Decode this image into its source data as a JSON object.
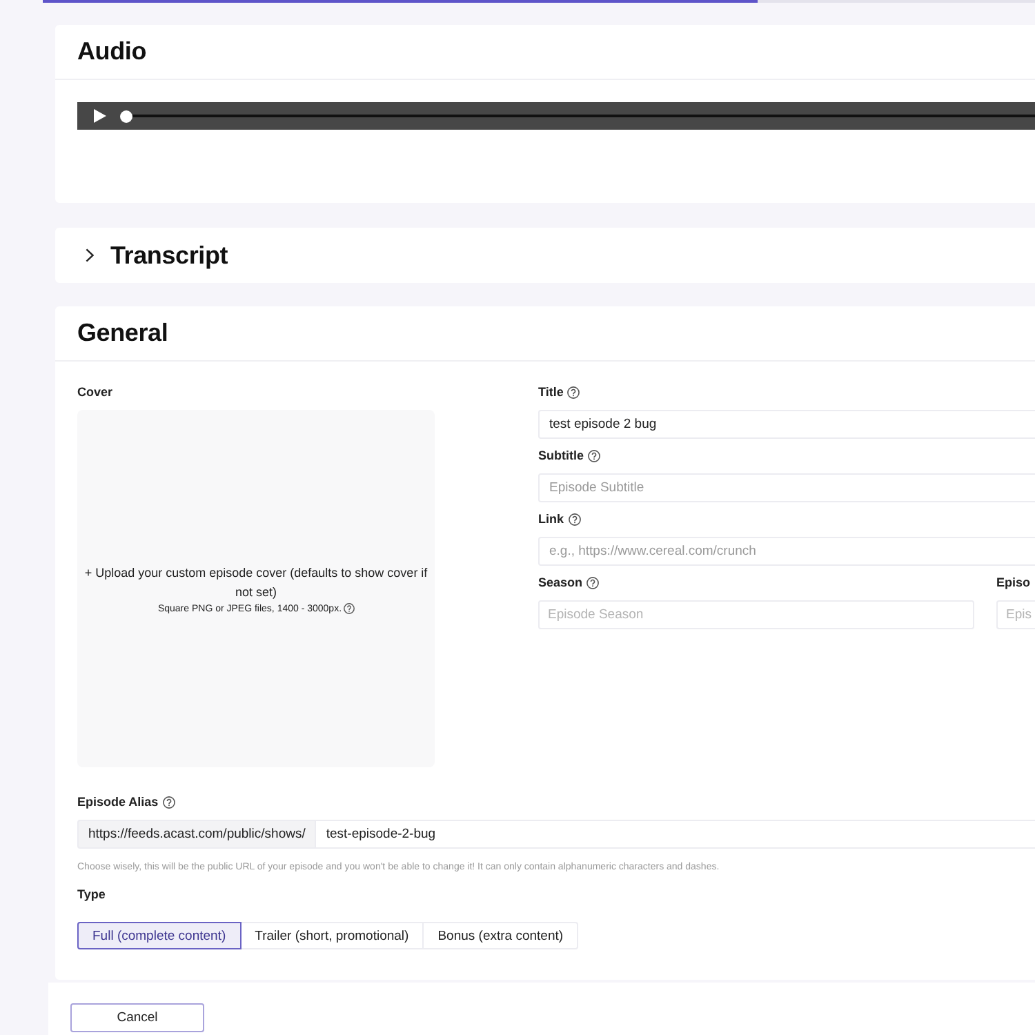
{
  "progress": {
    "level": 0.72
  },
  "audio_card": {
    "title": "Audio",
    "player": {
      "level": 0
    }
  },
  "transcript_card": {
    "title": "Transcript",
    "expanded": false
  },
  "general_card": {
    "title": "General",
    "cover": {
      "label": "Cover",
      "upload_text": "+ Upload your custom episode cover (defaults to show cover if not set)",
      "hint": "Square PNG or JPEG files, 1400 - 3000px."
    },
    "fields": [
      {
        "label": "Title",
        "help": true,
        "value": "test episode 2 bug"
      },
      {
        "label": "Subtitle",
        "help": true,
        "placeholder": "Episode Subtitle"
      },
      {
        "label": "Link",
        "help": true,
        "placeholder": "e.g., https://www.cereal.com/crunch"
      }
    ],
    "season_fields": [
      {
        "label": "Season",
        "help": true,
        "placeholder": "Episode Season"
      },
      {
        "label": "Episo",
        "help": false,
        "placeholder": "Epis"
      }
    ],
    "alias": {
      "label": "Episode Alias",
      "help": true,
      "prefix": "https://feeds.acast.com/public/shows/",
      "value": "test-episode-2-bug",
      "help_text": "Choose wisely, this will be the public URL of your episode and you won't be able to change it! It can only contain alphanumeric characters and dashes."
    },
    "type": {
      "label": "Type",
      "options": [
        {
          "label": "Full (complete content)",
          "selected": true
        },
        {
          "label": "Trailer (short, promotional)",
          "selected": false
        },
        {
          "label": "Bonus (extra content)",
          "selected": false
        }
      ]
    }
  },
  "buttons": [
    {
      "label": "Cancel"
    }
  ]
}
